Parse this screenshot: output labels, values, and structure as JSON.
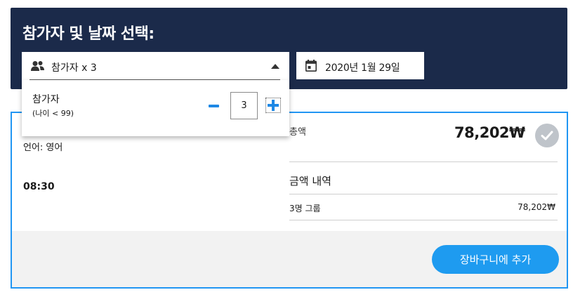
{
  "header": {
    "title": "참가자 및 날짜 선택:"
  },
  "participants_select": {
    "icon": "users-icon",
    "label": "참가자 x 3",
    "caret_icon": "caret-up-icon"
  },
  "date_button": {
    "icon": "calendar-icon",
    "label": "2020년 1월 29일"
  },
  "participants_dropdown": {
    "label": "참가자",
    "sublabel": "(나이 < 99)",
    "quantity": "3",
    "minus_icon": "minus-icon",
    "plus_icon": "plus-icon"
  },
  "card": {
    "language": "언어: 영어",
    "time": "08:30",
    "total_label": "총액",
    "total_amount": "78,202₩",
    "check_icon": "check-icon",
    "breakdown_title": "금액 내역",
    "group_label": "3명 그룹",
    "group_price": "78,202₩",
    "add_to_cart_label": "장바구니에 추가"
  },
  "colors": {
    "header_bg": "#1b2a4a",
    "accent": "#1e9bf0",
    "card_border": "#2196f3",
    "stepper": "#1e88e5"
  }
}
